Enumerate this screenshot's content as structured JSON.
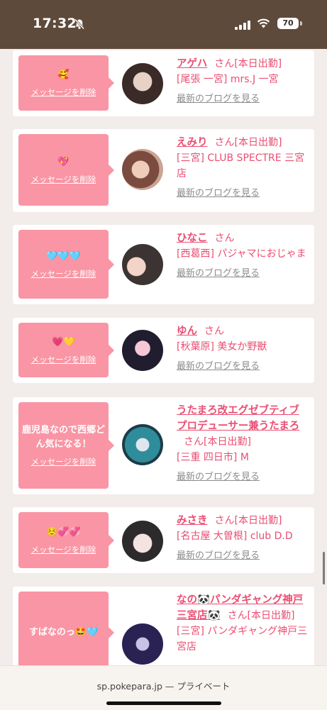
{
  "status": {
    "time": "17:32",
    "battery": "70",
    "icons": [
      "bell-off-icon",
      "signal-icon",
      "wifi-icon",
      "battery-icon"
    ]
  },
  "cards": [
    {
      "message": "🥰",
      "delete_label": "メッセージを削除",
      "name": "アゲハ",
      "san": "さん[本日出勤]",
      "area": "[尾張 一宮] mrs.J 一宮",
      "blog": "最新のブログを見る"
    },
    {
      "message": "💖",
      "delete_label": "メッセージを削除",
      "name": "えみり",
      "san": "さん[本日出勤]",
      "area": "[三宮] CLUB SPECTRE 三宮店",
      "blog": "最新のブログを見る"
    },
    {
      "message": "🩵🩵🩵",
      "delete_label": "メッセージを削除",
      "name": "ひなこ",
      "san": "さん",
      "area": "[西葛西] パジャマにおじゃま",
      "blog": "最新のブログを見る"
    },
    {
      "message": "💗💛",
      "delete_label": "メッセージを削除",
      "name": "ゆん",
      "san": "さん",
      "area": "[秋葉原] 美女か野獣",
      "blog": "最新のブログを見る"
    },
    {
      "message": "鹿児島なので西郷どん気になる！",
      "delete_label": "メッセージを削除",
      "name": "うたまろ改エグゼブティブプロデューサー兼うたまろ",
      "san": "さん[本日出勤]",
      "area": "[三重 四日市] M",
      "blog": "最新のブログを見る"
    },
    {
      "message": "☺️💞💞",
      "delete_label": "メッセージを削除",
      "name": "みさき",
      "san": "さん[本日出勤]",
      "area": "[名古屋 大曽根] club D.D",
      "blog": "最新のブログを見る"
    },
    {
      "message": "すばなのっ🤩🩵",
      "delete_label": "メッセージを削除",
      "name": "なの🐼パンダギャング神戸三宮店🐼",
      "san": "さん[本日出勤]",
      "area": "[三宮] パンダギャング神戸三宮店",
      "blog": ""
    }
  ],
  "browser": {
    "url": "sp.pokepara.jp — プライベート"
  },
  "colors": {
    "status_bar": "#5e4a3b",
    "bubble": "#f995a4",
    "accent": "#ea4e72"
  }
}
